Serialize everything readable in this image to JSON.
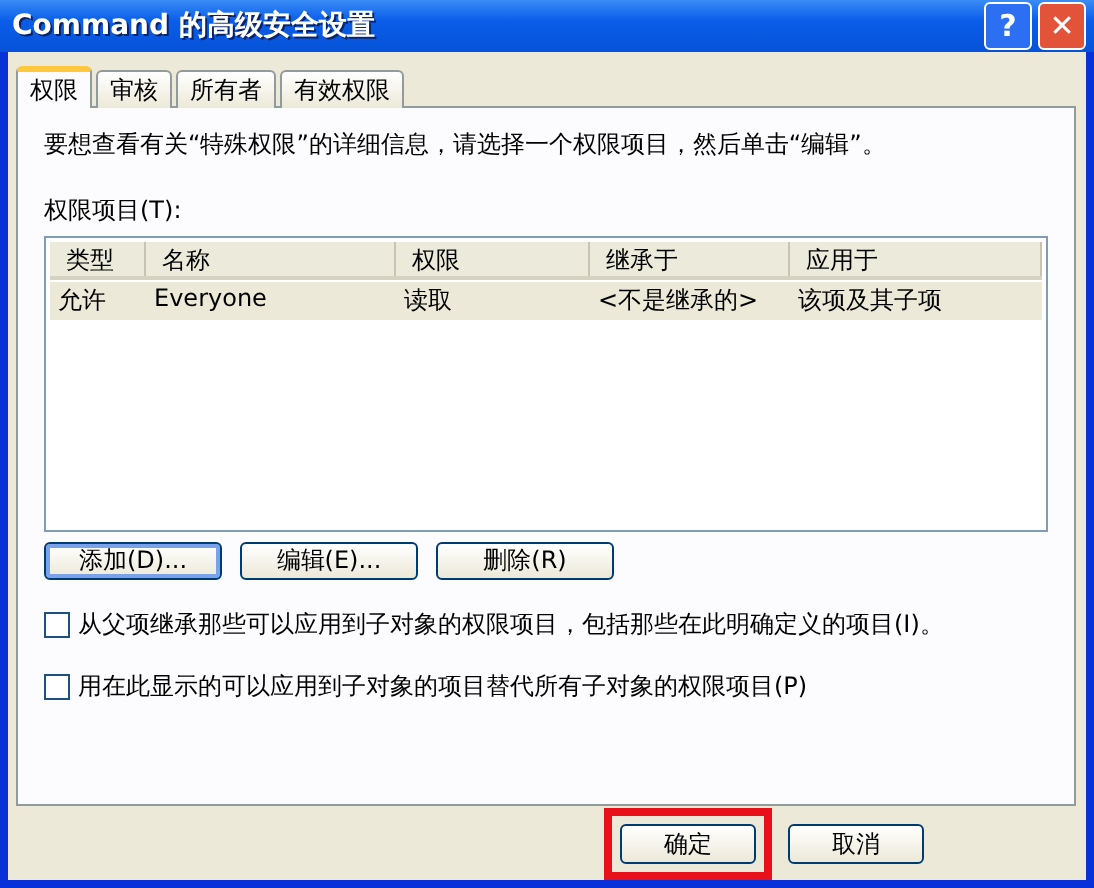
{
  "window": {
    "title": "Command 的高级安全设置",
    "buttons": [
      {
        "kind": "help",
        "label": "?"
      },
      {
        "kind": "close",
        "label": "✕"
      }
    ]
  },
  "tabs": [
    {
      "label": "权限",
      "selected": true
    },
    {
      "label": "审核",
      "selected": false
    },
    {
      "label": "所有者",
      "selected": false
    },
    {
      "label": "有效权限",
      "selected": false
    }
  ],
  "info": "要想查看有关“特殊权限”的详细信息，请选择一个权限项目，然后单击“编辑”。",
  "list_label": "权限项目(T):",
  "table": {
    "columns": [
      "类型",
      "名称",
      "权限",
      "继承于",
      "应用于"
    ],
    "rows": [
      {
        "cells": [
          "允许",
          "Everyone",
          "读取",
          "<不是继承的>",
          "该项及其子项"
        ],
        "selected": true
      }
    ]
  },
  "list_buttons": [
    {
      "label": "添加(D)...",
      "focused": true
    },
    {
      "label": "编辑(E)...",
      "focused": false
    },
    {
      "label": "删除(R)",
      "focused": false
    }
  ],
  "options": [
    {
      "label": "从父项继承那些可以应用到子对象的权限项目，包括那些在此明确定义的项目(I)。",
      "checked": false
    },
    {
      "label": "用在此显示的可以应用到子对象的项目替代所有子对象的权限项目(P)",
      "checked": false
    }
  ],
  "footer_buttons": [
    {
      "label": "确定",
      "highlighted": true
    },
    {
      "label": "取消",
      "highlighted": false
    }
  ]
}
